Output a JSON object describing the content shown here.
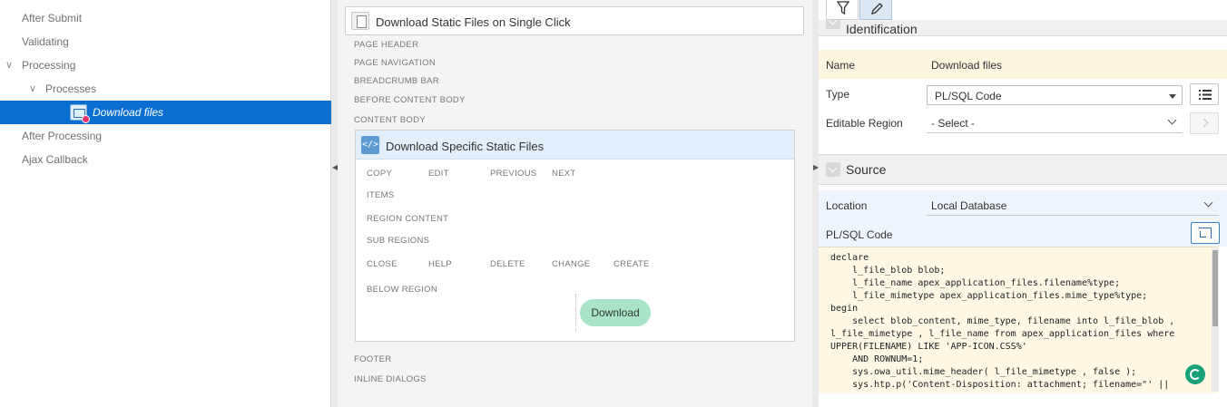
{
  "tree": {
    "nodes": [
      {
        "label": "After Submit",
        "toggle": ""
      },
      {
        "label": "Validating",
        "toggle": ""
      },
      {
        "label": "Processing",
        "toggle": "∨"
      },
      {
        "label": "Processes",
        "toggle": "∨"
      },
      {
        "label": "Download files",
        "toggle": "",
        "selected": true,
        "icon": "process-icon"
      },
      {
        "label": "After Processing",
        "toggle": ""
      },
      {
        "label": "Ajax Callback",
        "toggle": ""
      }
    ]
  },
  "layout": {
    "page_title": "Download Static Files on Single Click",
    "slots": {
      "page_header": "PAGE HEADER",
      "page_navigation": "PAGE NAVIGATION",
      "breadcrumb_bar": "BREADCRUMB BAR",
      "before_content_body": "BEFORE CONTENT BODY",
      "content_body": "CONTENT BODY",
      "footer": "FOOTER",
      "inline_dialogs": "INLINE DIALOGS"
    },
    "region": {
      "title": "Download Specific Static Files",
      "icon": "code-icon",
      "slots": {
        "copy": "COPY",
        "edit": "EDIT",
        "previous": "PREVIOUS",
        "next": "NEXT",
        "items": "ITEMS",
        "region_content": "REGION CONTENT",
        "sub_regions": "SUB REGIONS",
        "close": "CLOSE",
        "help": "HELP",
        "delete": "DELETE",
        "change": "CHANGE",
        "create": "CREATE",
        "below_region": "BELOW REGION"
      },
      "button_label": "Download",
      "button_color": "#a9e4c8"
    }
  },
  "properties": {
    "toolbar": {
      "filter_icon": "filter-icon",
      "edit_icon": "pencil-icon"
    },
    "identification": {
      "section_title": "Identification",
      "name_label": "Name",
      "name_value": "Download files",
      "type_label": "Type",
      "type_value": "PL/SQL Code",
      "editable_region_label": "Editable Region",
      "editable_region_value": "- Select -"
    },
    "source": {
      "section_title": "Source",
      "location_label": "Location",
      "location_value": "Local Database",
      "code_label": "PL/SQL Code",
      "code": "declare\n    l_file_blob blob;\n    l_file_name apex_application_files.filename%type;\n    l_file_mimetype apex_application_files.mime_type%type;\nbegin\n    select blob_content, mime_type, filename into l_file_blob ,\nl_file_mimetype , l_file_name from apex_application_files where\nUPPER(FILENAME) LIKE 'APP-ICON.CSS%'\n    AND ROWNUM=1;\n    sys.owa_util.mime_header( l_file_mimetype , false );\n    sys.htp.p('Content-Disposition: attachment; filename=\"' ||"
    },
    "colors": {
      "accent": "#0a6fd0",
      "status": "#19a17a"
    }
  }
}
